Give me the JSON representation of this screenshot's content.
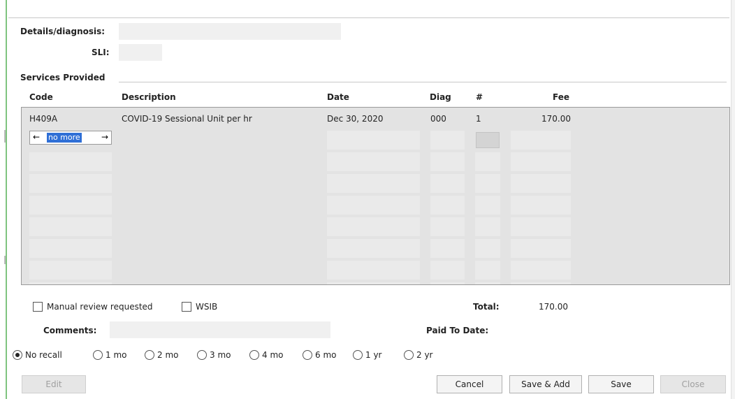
{
  "form": {
    "details_label": "Details/diagnosis:",
    "details_value": "",
    "sli_label": "SLI:",
    "sli_value": ""
  },
  "services": {
    "section_title": "Services Provided",
    "columns": [
      "Code",
      "Description",
      "Date",
      "Diag",
      "#",
      "Fee"
    ],
    "rows": [
      {
        "code": "H409A",
        "description": "COVID-19 Sessional Unit per hr",
        "date": "Dec 30, 2020",
        "diag": "000",
        "count": "1",
        "fee": "170.00"
      }
    ],
    "editor_text": "no more"
  },
  "options": {
    "manual_review_label": "Manual review requested",
    "manual_review_checked": false,
    "wsib_label": "WSIB",
    "wsib_checked": false
  },
  "totals": {
    "total_label": "Total:",
    "total_value": "170.00",
    "paid_label": "Paid To Date:",
    "paid_value": ""
  },
  "comments": {
    "label": "Comments:",
    "value": ""
  },
  "recall": {
    "selected": "No recall",
    "options": [
      "No recall",
      "1 mo",
      "2 mo",
      "3 mo",
      "4 mo",
      "6 mo",
      "1 yr",
      "2 yr"
    ]
  },
  "buttons": {
    "edit": "Edit",
    "cancel": "Cancel",
    "save_add": "Save & Add",
    "save": "Save",
    "close": "Close"
  },
  "colors": {
    "accent_bar": "#7fc47f",
    "selection": "#2f6fd6",
    "grid_background": "#e3e3e3"
  },
  "icons": {
    "editor_left": "arrow-left-icon",
    "editor_right": "arrow-right-icon"
  }
}
